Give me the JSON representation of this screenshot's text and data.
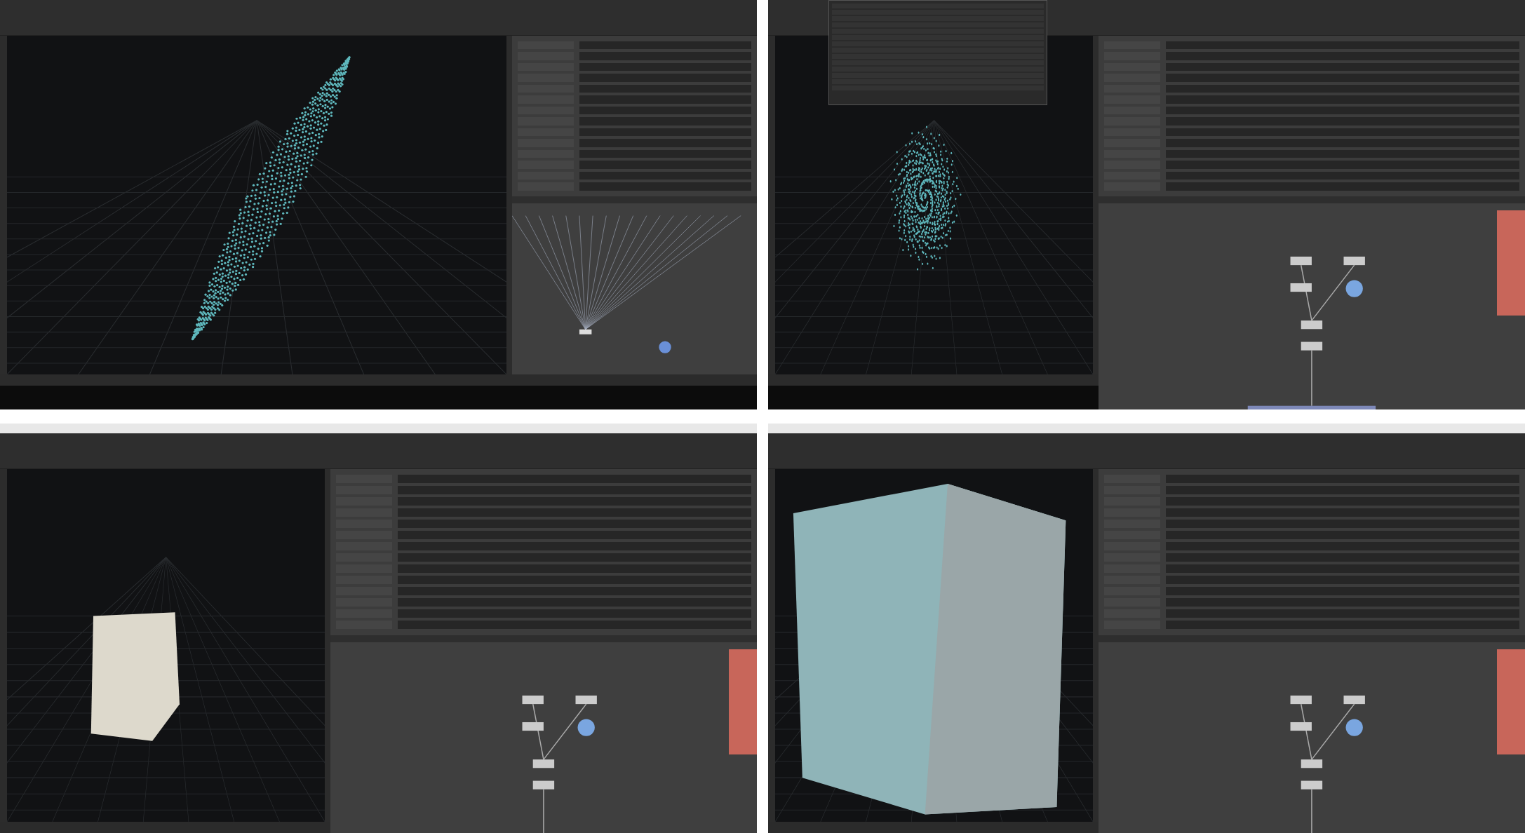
{
  "quadrants": [
    {
      "kind": "point-streak",
      "title_bar": false,
      "taskbar": true,
      "spreadsheet": false,
      "error_panel": false
    },
    {
      "kind": "point-cloud",
      "title_bar": false,
      "taskbar": true,
      "spreadsheet": true,
      "error_panel": true
    },
    {
      "kind": "white-cube",
      "title_bar": true,
      "taskbar": false,
      "spreadsheet": false,
      "error_panel": true
    },
    {
      "kind": "textured-cube",
      "title_bar": true,
      "taskbar": false,
      "spreadsheet": false,
      "error_panel": true
    }
  ]
}
